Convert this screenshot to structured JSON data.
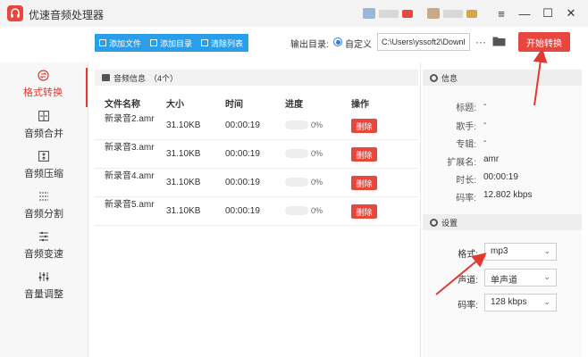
{
  "app": {
    "title": "优速音频处理器"
  },
  "window_controls": {
    "menu": "≡",
    "minimize": "—",
    "maximize": "☐",
    "close": "✕"
  },
  "sidebar": {
    "items": [
      {
        "label": "格式转换",
        "icon": "format-convert-icon",
        "active": true
      },
      {
        "label": "音频合并",
        "icon": "merge-icon"
      },
      {
        "label": "音频压缩",
        "icon": "compress-icon"
      },
      {
        "label": "音频分割",
        "icon": "split-icon"
      },
      {
        "label": "音频变速",
        "icon": "speed-icon"
      },
      {
        "label": "音量调整",
        "icon": "volume-adjust-icon"
      }
    ]
  },
  "toolbar": {
    "add_file": "添加文件",
    "add_folder": "添加目录",
    "clear_list": "清除列表",
    "output_label": "输出目录:",
    "output_option": "自定义",
    "output_path": "C:\\Users\\yssoft2\\Downl",
    "more": "···",
    "start": "开始转换"
  },
  "file_panel": {
    "title": "音频信息",
    "count": "（4个）",
    "columns": [
      "文件名称",
      "大小",
      "时间",
      "进度",
      "操作"
    ],
    "rows": [
      {
        "name": "新录音2.amr",
        "size": "31.10KB",
        "time": "00:00:19",
        "progress": 0,
        "progress_text": "0%",
        "action": "删除"
      },
      {
        "name": "新录音3.amr",
        "size": "31.10KB",
        "time": "00:00:19",
        "progress": 0,
        "progress_text": "0%",
        "action": "删除"
      },
      {
        "name": "新录音4.amr",
        "size": "31.10KB",
        "time": "00:00:19",
        "progress": 0,
        "progress_text": "0%",
        "action": "删除"
      },
      {
        "name": "新录音5.amr",
        "size": "31.10KB",
        "time": "00:00:19",
        "progress": 0,
        "progress_text": "0%",
        "action": "删除"
      }
    ]
  },
  "info_panel": {
    "title": "信息",
    "fields": [
      {
        "label": "标题:",
        "value": "-"
      },
      {
        "label": "歌手:",
        "value": "-"
      },
      {
        "label": "专辑:",
        "value": "-"
      },
      {
        "label": "扩展名:",
        "value": "amr"
      },
      {
        "label": "时长:",
        "value": "00:00:19"
      },
      {
        "label": "码率:",
        "value": "12.802 kbps"
      }
    ]
  },
  "settings_panel": {
    "title": "设置",
    "format_label": "格式:",
    "format_value": "mp3",
    "channel_label": "声道:",
    "channel_value": "单声道",
    "bitrate_label": "码率:",
    "bitrate_value": "128 kbps"
  },
  "colors": {
    "accent": "#e8473f",
    "toolbar_blue": "#2a9ee8"
  }
}
